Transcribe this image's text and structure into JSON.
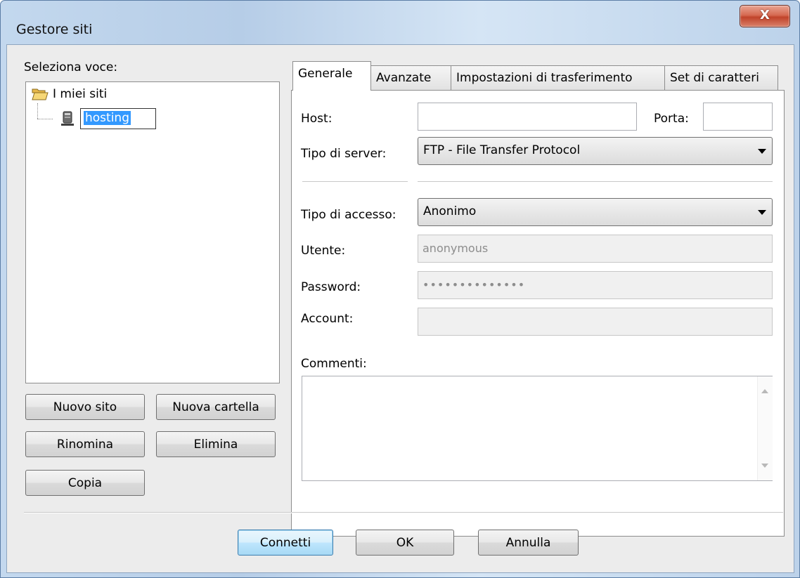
{
  "window": {
    "title": "Gestore siti",
    "close_label": "X"
  },
  "left": {
    "select_label": "Seleziona voce:",
    "tree": {
      "root_label": "I miei siti",
      "child_label": "hosting"
    },
    "buttons": {
      "new_site": "Nuovo sito",
      "new_folder": "Nuova cartella",
      "rename": "Rinomina",
      "delete": "Elimina",
      "copy": "Copia"
    }
  },
  "tabs": [
    "Generale",
    "Avanzate",
    "Impostazioni di trasferimento",
    "Set di caratteri"
  ],
  "general": {
    "host_label": "Host:",
    "host_value": "",
    "port_label": "Porta:",
    "port_value": "",
    "server_type_label": "Tipo di server:",
    "server_type_value": "FTP - File Transfer Protocol",
    "logon_type_label": "Tipo di accesso:",
    "logon_type_value": "Anonimo",
    "user_label": "Utente:",
    "user_value": "anonymous",
    "password_label": "Password:",
    "password_value": "••••••••••••••",
    "account_label": "Account:",
    "account_value": "",
    "comments_label": "Commenti:",
    "comments_value": ""
  },
  "footer": {
    "connect": "Connetti",
    "ok": "OK",
    "cancel": "Annulla"
  }
}
